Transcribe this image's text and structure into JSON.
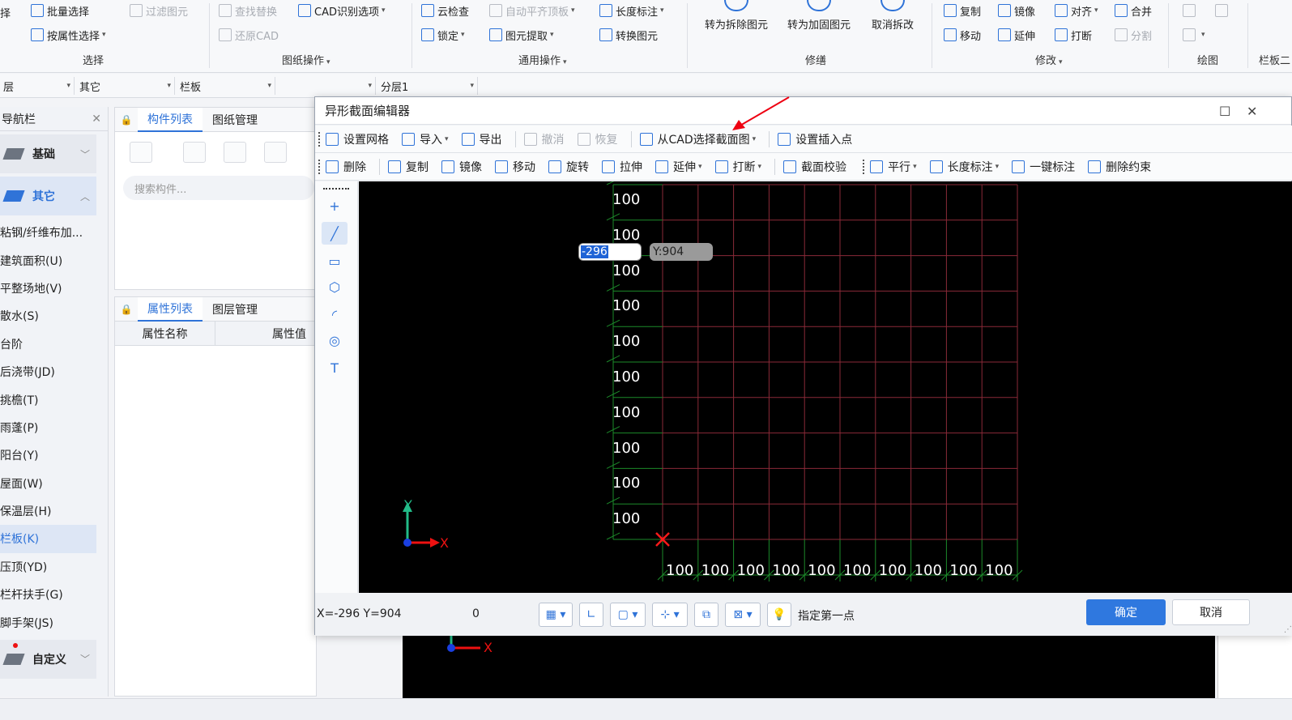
{
  "ribbon": {
    "select_group": {
      "batch_select": "批量选择",
      "filter_elements": "过滤图元",
      "attr_select": "按属性选择",
      "label": "选择",
      "left_cut": "择"
    },
    "drawing_group": {
      "find_replace": "查找替换",
      "cad_options": "CAD识别选项",
      "restore_cad": "还原CAD",
      "label": "图纸操作"
    },
    "common_group": {
      "cloud_check": "云检查",
      "auto_flat_top": "自动平齐顶板",
      "length_dim": "长度标注",
      "lock": "锁定",
      "extract": "图元提取",
      "convert": "转换图元",
      "label": "通用操作"
    },
    "repair_group": {
      "to_demolish": "转为拆除图元",
      "to_reinforce": "转为加固图元",
      "cancel_demolish": "取消拆改",
      "label": "修缮"
    },
    "modify_group": {
      "copy": "复制",
      "mirror": "镜像",
      "align": "对齐",
      "merge": "合并",
      "move": "移动",
      "extend": "延伸",
      "break": "打断",
      "split": "分割",
      "label": "修改"
    },
    "draw_group": {
      "label": "绘图"
    },
    "cut_label": "栏板二"
  },
  "floorbar": {
    "floor": "层",
    "category": "其它",
    "type": "栏板",
    "blank": "",
    "layer": "分层1"
  },
  "nav": {
    "title": "导航栏",
    "cat_basic": "基础",
    "cat_other": "其它",
    "cat_custom": "自定义",
    "items": [
      "粘钢/纤维布加...",
      "建筑面积(U)",
      "平整场地(V)",
      "散水(S)",
      "台阶",
      "后浇带(JD)",
      "挑檐(T)",
      "雨蓬(P)",
      "阳台(Y)",
      "屋面(W)",
      "保温层(H)",
      "栏板(K)",
      "压顶(YD)",
      "栏杆扶手(G)",
      "脚手架(JS)"
    ],
    "selected_index": 11
  },
  "complist": {
    "tab1": "构件列表",
    "tab2": "图纸管理",
    "search_placeholder": "搜索构件..."
  },
  "proplist": {
    "tab1": "属性列表",
    "tab2": "图层管理",
    "col_name": "属性名称",
    "col_value": "属性值"
  },
  "dialog": {
    "title": "异形截面编辑器",
    "toolbar1": {
      "set_grid": "设置网格",
      "import": "导入",
      "export": "导出",
      "undo": "撤消",
      "redo": "恢复",
      "from_cad": "从CAD选择截面图",
      "insert_point": "设置插入点"
    },
    "toolbar2": {
      "delete": "删除",
      "copy": "复制",
      "mirror": "镜像",
      "move": "移动",
      "rotate": "旋转",
      "stretch": "拉伸",
      "extend": "延伸",
      "break": "打断",
      "verify": "截面校验",
      "parallel": "平行",
      "length_dim": "长度标注",
      "auto_dim": "一键标注",
      "del_constraint": "删除约束"
    },
    "grid": {
      "y_labels": [
        "100",
        "100",
        "100",
        "100",
        "100",
        "100",
        "100",
        "100",
        "100",
        "100"
      ],
      "x_labels": [
        "100",
        "100",
        "100",
        "100",
        "100",
        "100",
        "100",
        "100",
        "100",
        "100"
      ]
    },
    "input_x": "-296",
    "input_y": "Y:904",
    "axis_y": "Y",
    "axis_x": "X",
    "status_coords": "X=-296 Y=904",
    "status_zero": "0",
    "status_prompt": "指定第一点",
    "ok": "确定",
    "cancel": "取消"
  },
  "bg_axis_x": "X"
}
